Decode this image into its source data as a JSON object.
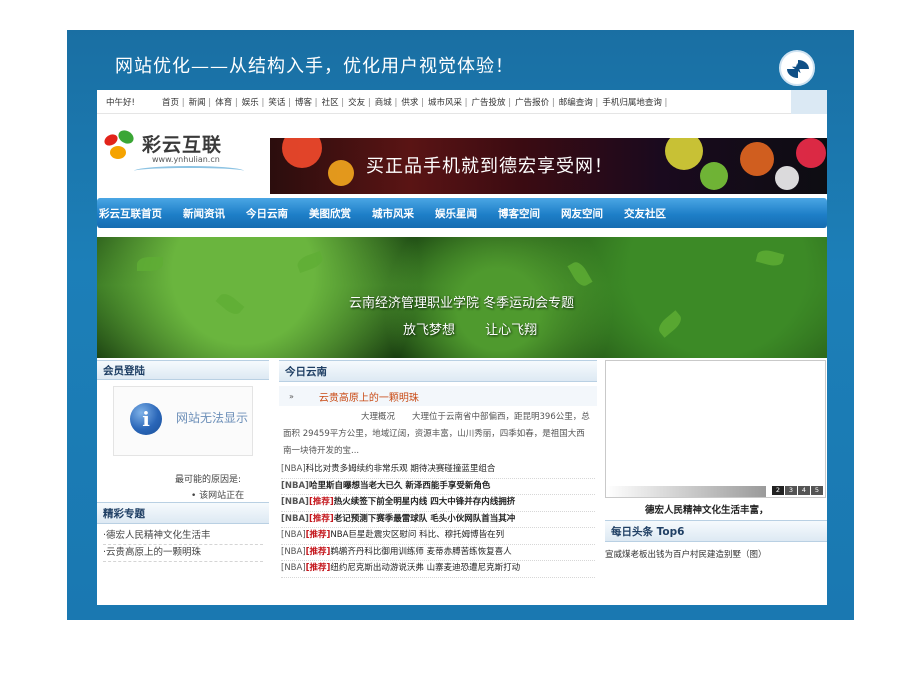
{
  "slide": {
    "title": "网站优化——从结构入手，优化用户视觉体验！"
  },
  "topnav": {
    "greeting": "中午好!",
    "links": [
      "首页",
      "新闻",
      "体育",
      "娱乐",
      "笑话",
      "博客",
      "社区",
      "交友",
      "商城",
      "供求",
      "城市风采",
      "广告投放",
      "广告报价",
      "邮编查询",
      "手机归属地查询"
    ]
  },
  "brand": {
    "name": "彩云互联",
    "url": "www.ynhulian.cn"
  },
  "banner": {
    "text": "买正品手机就到德宏享受网！"
  },
  "mainnav": {
    "items": [
      "彩云互联首页",
      "新闻资讯",
      "今日云南",
      "美图欣赏",
      "城市风采",
      "娱乐星闻",
      "博客空间",
      "网友空间",
      "交友社区"
    ]
  },
  "hero": {
    "line1": "云南经济管理职业学院 冬季运动会专题",
    "line2": "放飞梦想 让心飞翔"
  },
  "login": {
    "title": "会员登陆",
    "error": "网站无法显示",
    "reason": "最可能的原因是:",
    "bullet": "• 该网站正在"
  },
  "special": {
    "title": "精彩专题",
    "items": [
      "·德宏人民精神文化生活丰",
      "·云贵高原上的一颗明珠"
    ]
  },
  "today": {
    "title": "今日云南",
    "feature_bullet": "»",
    "feature": "云贵高原上的一颗明珠",
    "summary": "大理概况　　大理位于云南省中部偏西，距昆明396公里，总面积 29459平方公里，地域辽阔，资源丰富，山川秀丽，四季如春，是祖国大西南一块待开发的宝...",
    "news": [
      {
        "tag": "[NBA]",
        "rec": "",
        "text": "科比对贵多姆续约非常乐观 期待决赛碰撞蓝里组合",
        "bold": false
      },
      {
        "tag": "[NBA]",
        "rec": "",
        "text": "哈里斯自曝想当老大已久 新泽西能手享受新角色",
        "bold": true
      },
      {
        "tag": "[NBA]",
        "rec": "[推荐]",
        "text": "热火续签下前全明星内线 四大中锋并存内线拥挤",
        "bold": true
      },
      {
        "tag": "[NBA]",
        "rec": "[推荐]",
        "text": "老记预测下赛季最雷球队 毛头小伙网队首当其冲",
        "bold": true
      },
      {
        "tag": "[NBA]",
        "rec": "[推荐]",
        "text": "NBA巨星赴震灾区慰问 科比、穆托姆博皆在列",
        "bold": false
      },
      {
        "tag": "[NBA]",
        "rec": "[推荐]",
        "text": "鹈鹕齐丹科比御用训练师 麦蒂赤膊苦练恢复喜人",
        "bold": false
      },
      {
        "tag": "[NBA]",
        "rec": "[推荐]",
        "text": "纽约尼克斯出动游说沃弗 山寨麦迪恐遭尼克斯打动",
        "bold": false
      }
    ]
  },
  "photo": {
    "pages": [
      "2",
      "3",
      "4",
      "5"
    ],
    "caption": "德宏人民精神文化生活丰富，"
  },
  "top6": {
    "title": "每日头条  Top6",
    "item": "宣威煤老板出钱为百户村民建造别墅（图）"
  }
}
